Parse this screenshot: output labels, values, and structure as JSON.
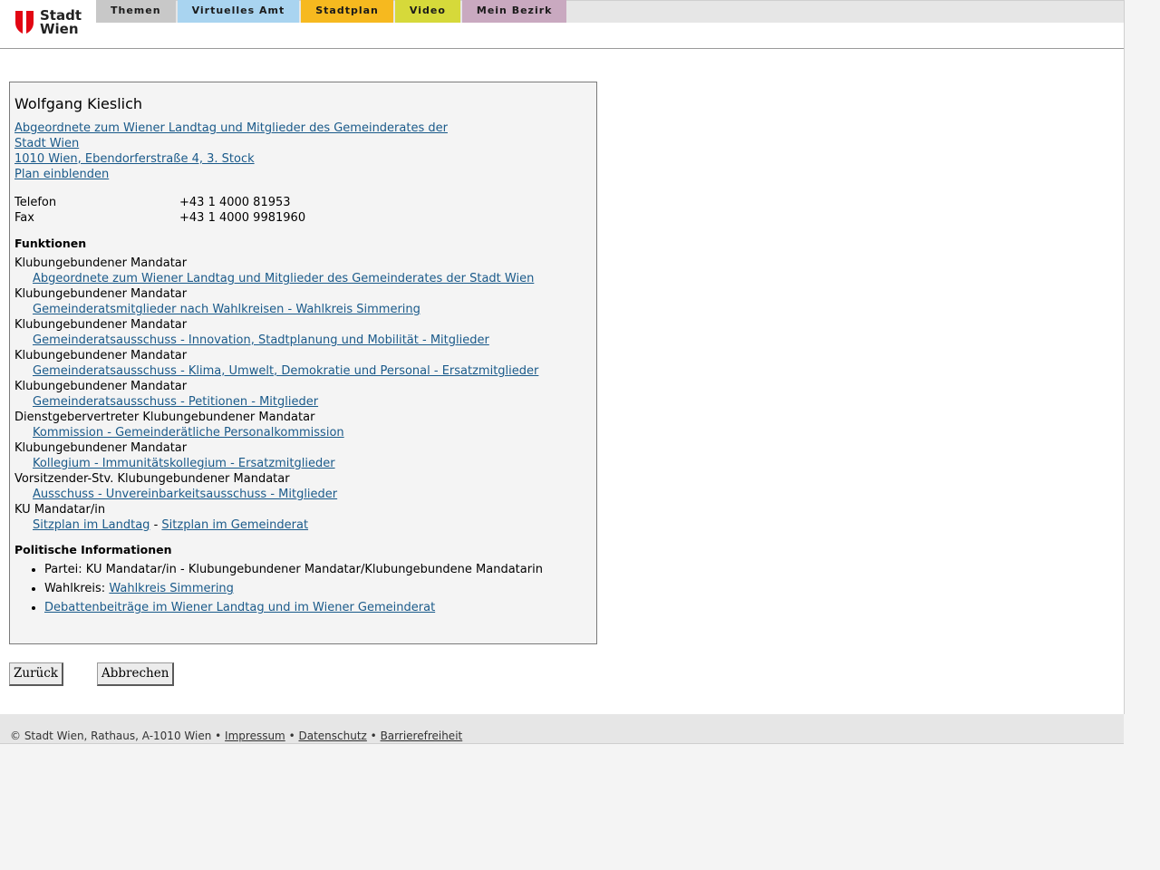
{
  "logo": {
    "line1": "Stadt",
    "line2": "Wien"
  },
  "nav": {
    "tabs": [
      {
        "label": "Themen",
        "color": "#c8c8c8"
      },
      {
        "label": "Virtuelles Amt",
        "color": "#a9d4f0"
      },
      {
        "label": "Stadtplan",
        "color": "#f6b91f"
      },
      {
        "label": "Video",
        "color": "#d6d93a"
      },
      {
        "label": "Mein Bezirk",
        "color": "#c9a9c0"
      }
    ]
  },
  "person": {
    "name": "Wolfgang Kieslich",
    "org_link": "Abgeordnete zum Wiener Landtag und Mitglieder des Gemeinderates der Stadt Wien ",
    "address": "1010 Wien, Ebendorferstraße 4, 3. Stock",
    "plan_link": "Plan einblenden",
    "phone_label": "Telefon",
    "phone": "+43 1 4000 81953",
    "fax_label": "Fax",
    "fax": "+43 1 4000 9981960"
  },
  "functions": {
    "title": "Funktionen",
    "items": [
      {
        "role": "Klubungebundener Mandatar",
        "link": "Abgeordnete zum Wiener Landtag und Mitglieder des Gemeinderates der Stadt Wien"
      },
      {
        "role": "Klubungebundener Mandatar",
        "link": "Gemeinderatsmitglieder nach Wahlkreisen - Wahlkreis Simmering"
      },
      {
        "role": "Klubungebundener Mandatar",
        "link": "Gemeinderatsausschuss - Innovation, Stadtplanung und Mobilität - Mitglieder"
      },
      {
        "role": "Klubungebundener Mandatar",
        "link": "Gemeinderatsausschuss - Klima, Umwelt, Demokratie und Personal - Ersatzmitglieder"
      },
      {
        "role": "Klubungebundener Mandatar",
        "link": "Gemeinderatsausschuss - Petitionen - Mitglieder"
      },
      {
        "role": "Dienstgebervertreter Klubungebundener Mandatar",
        "link": "Kommission - Gemeinderätliche Personalkommission"
      },
      {
        "role": "Klubungebundener Mandatar",
        "link": "Kollegium - Immunitätskollegium - Ersatzmitglieder"
      },
      {
        "role": "Vorsitzender-Stv. Klubungebundener Mandatar",
        "link": "Ausschuss - Unvereinbarkeitsausschuss - Mitglieder"
      }
    ],
    "last_role": "KU Mandatar/in",
    "seat_landtag": "Sitzplan im Landtag",
    "seat_sep": "-",
    "seat_gemeinderat": "Sitzplan im Gemeinderat"
  },
  "political": {
    "title": "Politische Informationen",
    "party": "Partei: KU Mandatar/in - Klubungebundener Mandatar/Klubungebundene Mandatarin",
    "district_label": "Wahlkreis:",
    "district_link": "Wahlkreis Simmering",
    "debates_link": "Debattenbeiträge im Wiener Landtag und im Wiener Gemeinderat"
  },
  "buttons": {
    "back": "Zurück",
    "cancel": "Abbrechen"
  },
  "footer": {
    "copyright": "© Stadt Wien, Rathaus, A-1010 Wien",
    "bullet": "•",
    "impressum": "Impressum",
    "datenschutz": "Datenschutz",
    "barrierefreiheit": "Barrierefreiheit"
  },
  "colors": {
    "link": "#1a5a8a",
    "logo_red": "#e20613"
  }
}
